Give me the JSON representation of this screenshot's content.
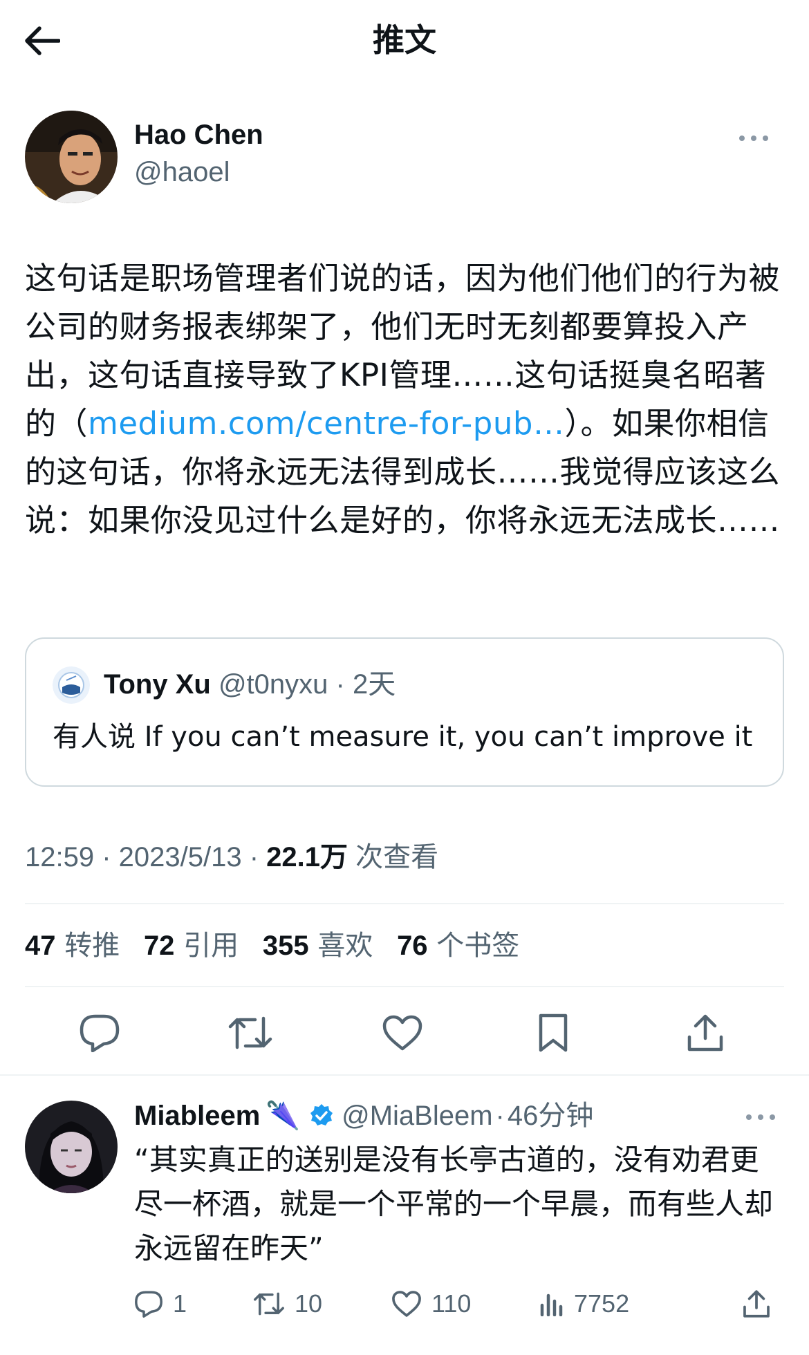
{
  "header": {
    "title": "推文"
  },
  "author": {
    "name": "Hao Chen",
    "handle": "@haoel"
  },
  "tweet": {
    "text_before": "这句话是职场管理者们说的话，因为他们他们的行为被公司的财务报表绑架了，他们无时无刻都要算投入产出，这句话直接导致了KPI管理……这句话挺臭名昭著的（",
    "link": "medium.com/centre-for-pub…",
    "text_after": "）。如果你相信的这句话，你将永远无法得到成长……我觉得应该这么说：如果你没见过什么是好的，你将永远无法成长……"
  },
  "quote": {
    "name": "Tony Xu",
    "handle": "@t0nyxu",
    "time": "2天",
    "text": "有人说 If you can’t measure it, you can’t improve it"
  },
  "meta": {
    "time": "12:59",
    "date": "2023/5/13",
    "views": "22.1万",
    "views_label": "次查看"
  },
  "stats": [
    {
      "count": "47",
      "label": "转推"
    },
    {
      "count": "72",
      "label": "引用"
    },
    {
      "count": "355",
      "label": "喜欢"
    },
    {
      "count": "76",
      "label": "个书签"
    }
  ],
  "actions": [
    "reply-icon",
    "retweet-icon",
    "like-icon",
    "bookmark-icon",
    "share-icon"
  ],
  "reply": {
    "name": "Miableem",
    "emoji": "🌂",
    "handle": "@MiaBleem",
    "time": "46分钟",
    "text": "“其实真正的送别是没有长亭古道的，没有劝君更尽一杯酒，就是一个平常的一个早晨，而有些人却永远留在昨天”",
    "replies": "1",
    "retweets": "10",
    "likes": "110",
    "views": "7752"
  },
  "colors": {
    "accent": "#1d9bf0",
    "muted": "#536471",
    "text": "#0f1419",
    "border": "#cfd9de"
  }
}
